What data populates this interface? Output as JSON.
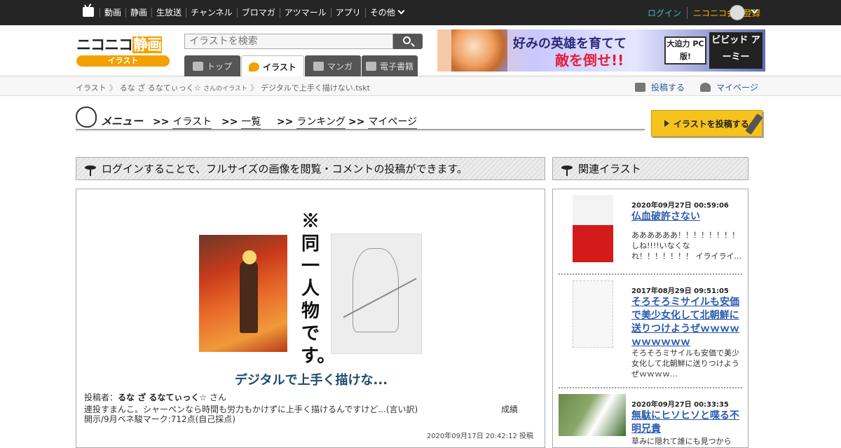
{
  "topbar": {
    "nav": [
      "動画",
      "静画",
      "生放送",
      "チャンネル",
      "ブロマガ",
      "アツマール",
      "アプリ",
      "その他"
    ],
    "login": "ログイン",
    "register": "ニコニコ会員登録"
  },
  "header": {
    "logo_main": "ニコニコ",
    "logo_hl": "静画",
    "logo_sub": "イラスト",
    "search_placeholder": "イラストを検索",
    "tabs": [
      "トップ",
      "イラスト",
      "マンガ",
      "電子書籍"
    ],
    "banner": {
      "line1": "好みの英雄を育てて",
      "line2": "敵を倒せ!!",
      "badge": "大迫力 PC版!",
      "brand": "ビビッド アーミー"
    }
  },
  "breadcrumb": {
    "root": "イラスト",
    "author": "るな ざ るなてぃっく☆",
    "author_suffix": "さんのイラスト",
    "current": "デジタルで上手く描けない.tskt",
    "post": "投稿する",
    "mypage": "マイページ"
  },
  "menu": {
    "title": "メニュー",
    "items": [
      "イラスト",
      "一覧",
      "ランキング",
      "マイページ"
    ],
    "post_button": "イラストを投稿する"
  },
  "main": {
    "notice": "ログインすることで、フルサイズの画像を閲覧・コメントの投稿ができます。",
    "art_caption": "※同一人物です。",
    "title": "デジタルで上手く描けな...",
    "poster_label": "投稿者：",
    "poster_name": "るな ざ るなてぃっく☆",
    "poster_suffix": " さん",
    "desc1": "連投すまんこ。シャーペンなら時間も労力もかけずに上手く描けるんですけど...(言い訳)",
    "desc1_right": "成績",
    "desc2": "開示/9月ベネ駿マーク:712点(自己採点)",
    "date": "2020年09月17日 20:42:12 投稿"
  },
  "related": {
    "heading": "関連イラスト",
    "items": [
      {
        "date": "2020年09月27日 00:59:06",
        "title": "仏血破許さない",
        "desc": "ああああああ！！！！！！！！しね!!!!いなくなれ！！！！！！！ イライライ..."
      },
      {
        "date": "2017年08月29日 09:51:05",
        "title": "そろそろミサイルも安価で美少女化して北朝鮮に送りつけようぜｗｗｗｗｗｗｗｗｗｗ",
        "desc": "そろそろミサイルも安価で美少女化して北朝鮮に送りつけようぜｗｗｗｗ..."
      },
      {
        "date": "2020年09月27日 00:33:35",
        "title": "無駄にヒソヒソと喋る不明兄貴",
        "desc": "草みに隠れて誰にも見つから"
      }
    ]
  }
}
